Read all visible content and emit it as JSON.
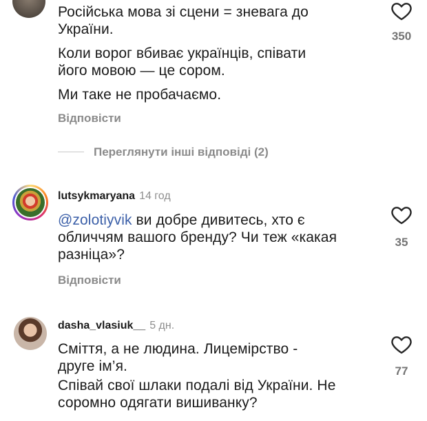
{
  "comments": [
    {
      "lines": [
        "Російська мова зі сцени = зневага до",
        "України.",
        "Коли ворог вбиває українців, співати",
        "його мовою — це сором.",
        "Ми таке не пробачаємо."
      ],
      "reply_label": "Відповісти",
      "likes": "350"
    },
    {
      "username": "lutsykmaryana",
      "time": "14 год",
      "mention": "@zolotiyvik",
      "lines": [
        "ви добре дивитесь, хто є",
        "обличчям вашого бренду? Чи теж «какая",
        "разніца»?"
      ],
      "reply_label": "Відповісти",
      "likes": "35"
    },
    {
      "username": "dasha_vlasiuk__",
      "time": "5 дн.",
      "lines": [
        "Сміття, а не людина. Лицемірство -",
        "друге ім’я.",
        "Співай свої шлаки подалі від України. Не",
        "соромно одягати вишиванку?"
      ],
      "likes": "77"
    }
  ],
  "view_more_replies": "Переглянути інші відповіді (2)",
  "icons": {
    "like": "heart-outline-icon"
  },
  "colors": {
    "mention": "#3b5fa8",
    "story_ring": "#e1306c"
  }
}
